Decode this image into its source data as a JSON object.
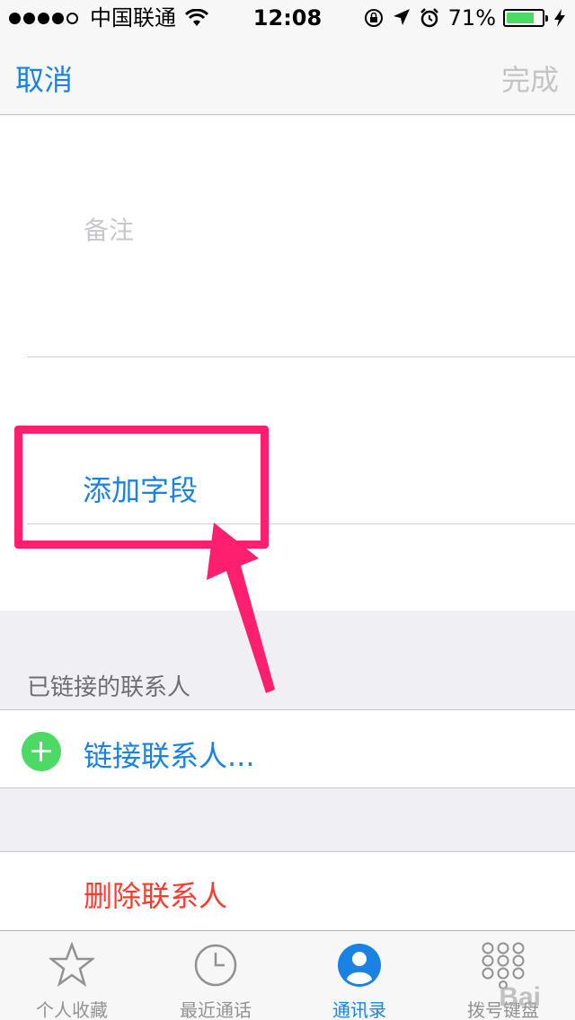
{
  "status_bar": {
    "carrier": "中国联通",
    "time": "12:08",
    "battery_percent": "71%",
    "battery_level": 0.71,
    "signal_bars_filled": 4,
    "signal_bars_total": 5
  },
  "nav": {
    "cancel_label": "取消",
    "done_label": "完成"
  },
  "form": {
    "notes_placeholder": "备注",
    "add_field_label": "添加字段"
  },
  "linked_contacts": {
    "header": "已链接的联系人",
    "link_label": "链接联系人..."
  },
  "delete_label": "删除联系人",
  "tabs": [
    {
      "label": "个人收藏",
      "icon": "star-icon",
      "active": false
    },
    {
      "label": "最近通话",
      "icon": "clock-icon",
      "active": false
    },
    {
      "label": "通讯录",
      "icon": "contacts-icon",
      "active": true
    },
    {
      "label": "拨号键盘",
      "icon": "keypad-icon",
      "active": false
    }
  ],
  "watermark": "Bai",
  "colors": {
    "accent": "#1a82e2",
    "destructive": "#ff3b30",
    "add_green": "#4cd964",
    "highlight": "#ff1f6e"
  }
}
